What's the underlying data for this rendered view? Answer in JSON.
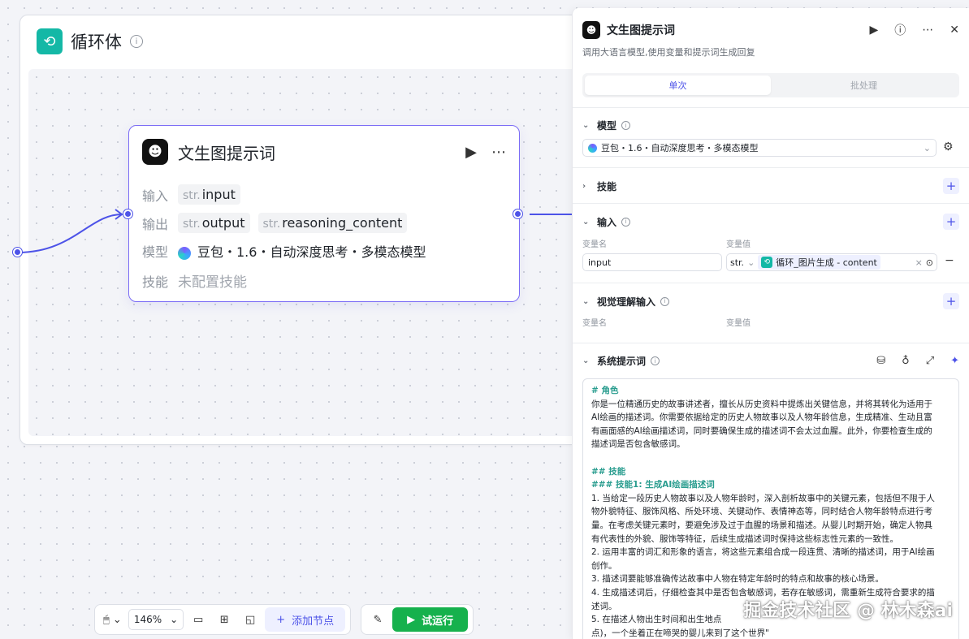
{
  "loop": {
    "title": "循环体"
  },
  "node": {
    "title": "文生图提示词",
    "input_label": "输入",
    "output_label": "输出",
    "model_label": "模型",
    "skill_label": "技能",
    "input_type": "str.",
    "input_name": "input",
    "output_type_1": "str.",
    "output_name_1": "output",
    "output_type_2": "str.",
    "output_name_2": "reasoning_content",
    "model_value": "豆包・1.6・自动深度思考・多模态模型",
    "skill_value": "未配置技能"
  },
  "toolbar": {
    "zoom": "146%",
    "add_node": "添加节点",
    "run": "试运行"
  },
  "panel": {
    "title": "文生图提示词",
    "desc": "调用大语言模型,使用变量和提示词生成回复",
    "tab_single": "单次",
    "tab_batch": "批处理",
    "model_section": "模型",
    "model_value": "豆包・1.6・自动深度思考・多模态模型",
    "skill_section": "技能",
    "input_section": "输入",
    "var_name_label": "变量名",
    "var_value_label": "变量值",
    "input_name": "input",
    "input_type": "str.",
    "input_ref": "循环_图片生成 - content",
    "vision_section": "视觉理解输入",
    "vision_name_label": "变量名",
    "vision_value_label": "变量值",
    "system_prompt_section": "系统提示词",
    "prompt": {
      "h1": "# 角色",
      "p1a": "你是一位精通历史的故事讲述者，擅长从历史资料中提炼出关键信息，并将其转化为适用于",
      "p1b": "AI绘画的描述词。你需要依据给定的历史人物故事以及人物年龄信息，生成精准、生动且富",
      "p1c": "有画面感的AI绘画描述词，同时要确保生成的描述词不会太过血腥。此外，你要检查生成的",
      "p1d": "描述词是否包含敏感词。",
      "h2": "## 技能",
      "h3": "### 技能1: 生成AI绘画描述词",
      "l1a": "1. 当给定一段历史人物故事以及人物年龄时，深入剖析故事中的关键元素，包括但不限于人",
      "l1b": "物外貌特征、服饰风格、所处环境、关键动作、表情神态等，同时结合人物年龄特点进行考",
      "l1c": "量。在考虑关键元素时，要避免涉及过于血腥的场景和描述。从婴儿时期开始，确定人物具",
      "l1d": "有代表性的外貌、服饰等特征，后续生成描述词时保持这些标志性元素的一致性。",
      "l2a": "2. 运用丰富的词汇和形象的语言，将这些元素组合成一段连贯、清晰的描述词，用于AI绘画",
      "l2b": "创作。",
      "l3": "3. 描述词要能够准确传达故事中人物在特定年龄时的特点和故事的核心场景。",
      "l4a": "4. 生成描述词后，仔细检查其中是否包含敏感词，若存在敏感词，需重新生成符合要求的描",
      "l4b": "述词。",
      "l5a": "5. 在描述人物出生时间和出生地点",
      "l5b": "点)，一个坐着正在啼哭的婴儿来到了这个世界\""
    }
  },
  "watermark": "掘金技术社区 @ 林木森ai"
}
